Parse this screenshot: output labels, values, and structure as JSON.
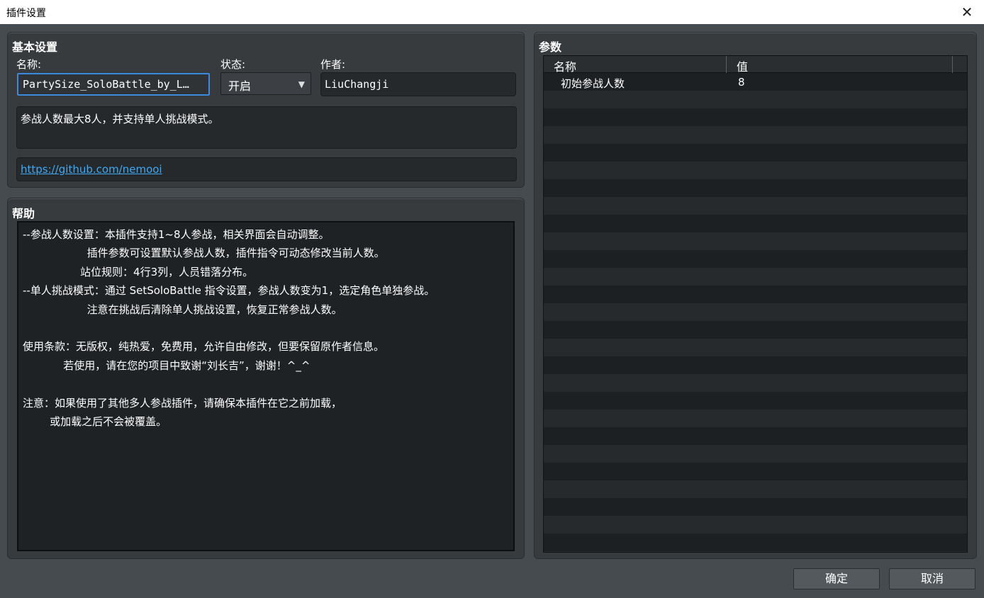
{
  "window": {
    "title": "插件设置",
    "close_glyph": "✕"
  },
  "basic": {
    "title": "基本设置",
    "name_label": "名称:",
    "name_value": "PartySize_SoloBattle_by_L…",
    "name_dots": "…",
    "status_label": "状态:",
    "status_value": "开启",
    "status_arrow": "▼",
    "author_label": "作者:",
    "author_value": "LiuChangji",
    "description": "参战人数最大8人，并支持单人挑战模式。",
    "url": "https://github.com/nemooi"
  },
  "help": {
    "title": "帮助",
    "text": "--参战人数设置：本插件支持1~8人参战，相关界面会自动调整。\n                   插件参数可设置默认参战人数，插件指令可动态修改当前人数。\n                 站位规则：4行3列，人员错落分布。\n--单人挑战模式：通过 SetSoloBattle 指令设置，参战人数变为1，选定角色单独参战。\n                   注意在挑战后清除单人挑战设置，恢复正常参战人数。\n\n使用条款：无版权，纯热爱，免费用，允许自由修改，但要保留原作者信息。\n            若使用，请在您的项目中致谢“刘长吉”，谢谢！^_^\n\n注意：如果使用了其他多人参战插件，请确保本插件在它之前加载，\n        或加载之后不会被覆盖。"
  },
  "params": {
    "title": "参数",
    "columns": [
      "名称",
      "值"
    ],
    "rows": [
      {
        "name": "初始参战人数",
        "value": "8"
      }
    ]
  },
  "buttons": {
    "ok": "确定",
    "cancel": "取消"
  }
}
